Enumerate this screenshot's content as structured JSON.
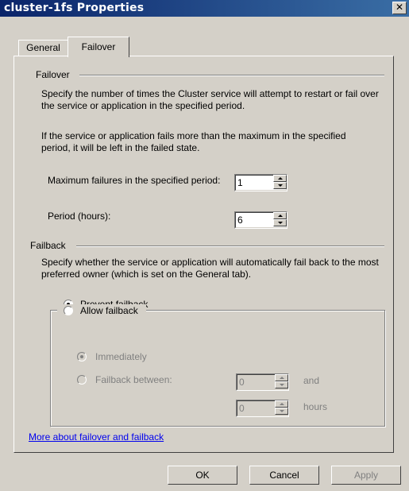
{
  "window": {
    "title": "cluster-1fs Properties",
    "close_glyph": "✕"
  },
  "tabs": [
    {
      "label": "General",
      "active": false
    },
    {
      "label": "Failover",
      "active": true
    }
  ],
  "failover": {
    "heading": "Failover",
    "description1": "Specify the number of times the Cluster service will attempt to restart or fail over the service or application in the specified period.",
    "description2": "If the service or application fails more than the maximum in the specified period, it will be left in the failed state.",
    "max_failures_label": "Maximum failures in the specified period:",
    "max_failures_value": "1",
    "period_label": "Period (hours):",
    "period_value": "6"
  },
  "failback": {
    "heading": "Failback",
    "description": "Specify whether the service or application will automatically fail back to the most preferred owner (which is set on the General tab).",
    "prevent_label": "Prevent failback",
    "allow_label": "Allow failback",
    "immediately_label": "Immediately",
    "between_label": "Failback between:",
    "between_start": "0",
    "and_label": "and",
    "between_end": "0",
    "hours_label": "hours",
    "selected": "prevent"
  },
  "link": {
    "label": "More about failover and failback"
  },
  "buttons": {
    "ok": "OK",
    "cancel": "Cancel",
    "apply": "Apply"
  }
}
